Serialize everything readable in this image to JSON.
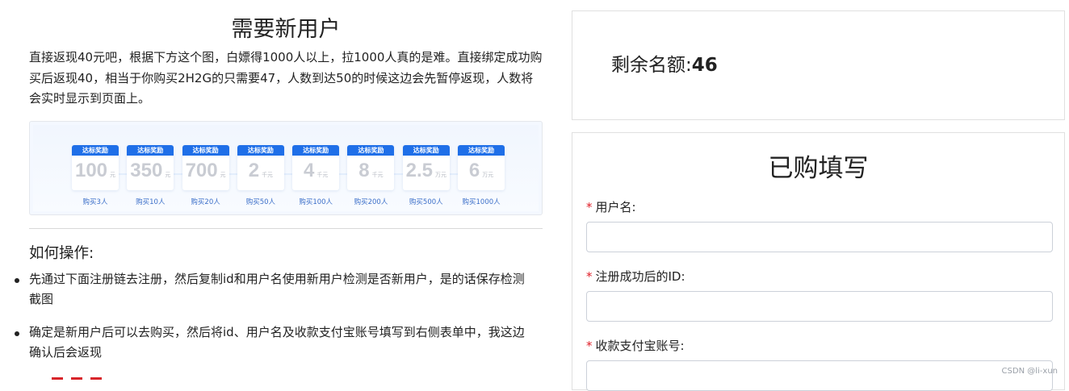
{
  "left": {
    "title": "需要新用户",
    "intro": "直接返现40元吧，根据下方这个图，白嫖得1000人以上，拉1000人真的是难。直接绑定成功购买后返现40，相当于你购买2H2G的只需要47，人数到达50的时候这边会先暂停返现，人数将会实时显示到页面上。",
    "tiers": [
      {
        "badge": "达标奖励",
        "value": "100",
        "unit": "元",
        "condition": "购买3人"
      },
      {
        "badge": "达标奖励",
        "value": "350",
        "unit": "元",
        "condition": "购买10人"
      },
      {
        "badge": "达标奖励",
        "value": "700",
        "unit": "元",
        "condition": "购买20人"
      },
      {
        "badge": "达标奖励",
        "value": "2",
        "unit": "千元",
        "condition": "购买50人"
      },
      {
        "badge": "达标奖励",
        "value": "4",
        "unit": "千元",
        "condition": "购买100人"
      },
      {
        "badge": "达标奖励",
        "value": "8",
        "unit": "千元",
        "condition": "购买200人"
      },
      {
        "badge": "达标奖励",
        "value": "2.5",
        "unit": "万元",
        "condition": "购买500人"
      },
      {
        "badge": "达标奖励",
        "value": "6",
        "unit": "万元",
        "condition": "购买1000人"
      }
    ],
    "howto_title": "如何操作:",
    "steps": [
      "先通过下面注册链去注册，然后复制id和用户名使用新用户检测是否新用户，是的话保存检测截图",
      "确定是新用户后可以去购买，然后将id、用户名及收款支付宝账号填写到右侧表单中，我这边确认后会返现"
    ]
  },
  "quota": {
    "label": "剩余名额:",
    "value": "46"
  },
  "form": {
    "title": "已购填写",
    "required_mark": "*",
    "fields": [
      {
        "label": "用户名:",
        "value": ""
      },
      {
        "label": "注册成功后的ID:",
        "value": ""
      },
      {
        "label": "收款支付宝账号:",
        "value": ""
      }
    ]
  },
  "watermark": "CSDN @li-xun",
  "colors": {
    "accent": "#1f6fe8",
    "required": "#e0202a"
  },
  "icons": {
    "step_bullet": "bullet-dot-icon"
  }
}
